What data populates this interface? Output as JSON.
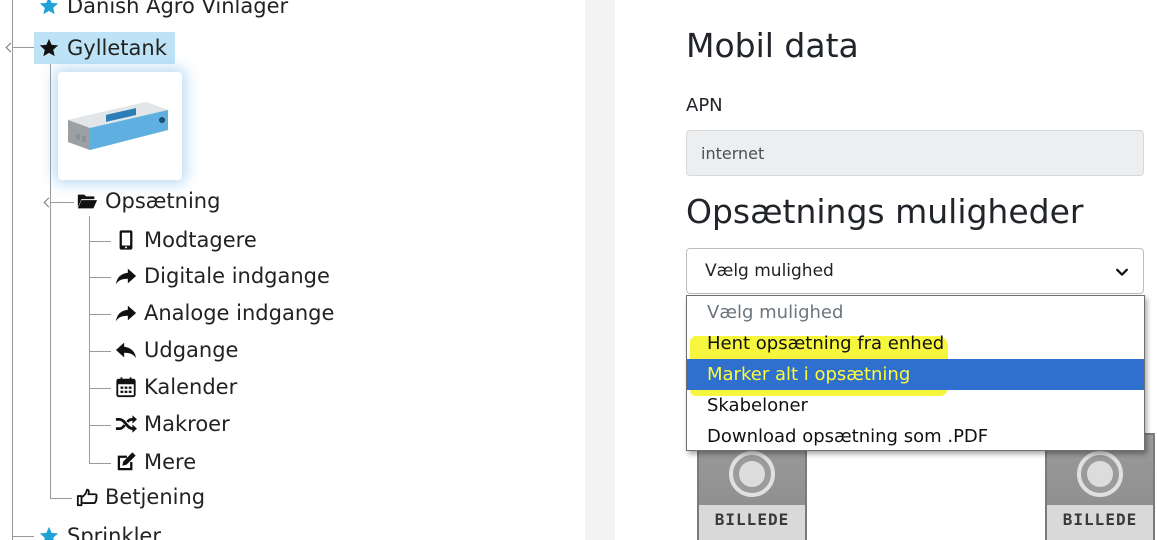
{
  "tree": {
    "items": [
      {
        "label": "Danish Agro Vinlager",
        "icon": "star-icon"
      },
      {
        "label": "Gylletank",
        "icon": "star-icon",
        "selected": true
      },
      {
        "label": "Opsætning",
        "icon": "folder-open-icon"
      },
      {
        "label": "Modtagere",
        "icon": "mobile-icon"
      },
      {
        "label": "Digitale indgange",
        "icon": "share-arrow-icon"
      },
      {
        "label": "Analoge indgange",
        "icon": "share-arrow-icon"
      },
      {
        "label": "Udgange",
        "icon": "reply-arrow-icon"
      },
      {
        "label": "Kalender",
        "icon": "calendar-icon"
      },
      {
        "label": "Makroer",
        "icon": "shuffle-icon"
      },
      {
        "label": "Mere",
        "icon": "edit-icon"
      },
      {
        "label": "Betjening",
        "icon": "hand-pointer-icon"
      },
      {
        "label": "Sprinkler",
        "icon": "star-icon"
      }
    ]
  },
  "form": {
    "mobile_heading": "Mobil data",
    "apn_label": "APN",
    "apn_value": "internet",
    "options_heading": "Opsætnings muligheder",
    "select_value": "Vælg mulighed",
    "dropdown_options": [
      "Vælg mulighed",
      "Hent opsætning fra enhed",
      "Marker alt i opsætning",
      "Skabeloner",
      "Download opsætning som .PDF"
    ],
    "highlighted_option": "Marker alt i opsætning",
    "image_placeholder_caption": "BILLEDE"
  },
  "colors": {
    "star": "#1fa3d6",
    "selected_bg": "#bfe3f6",
    "option_active_bg": "#2f6fce",
    "marker_yellow": "#f4f51c"
  }
}
